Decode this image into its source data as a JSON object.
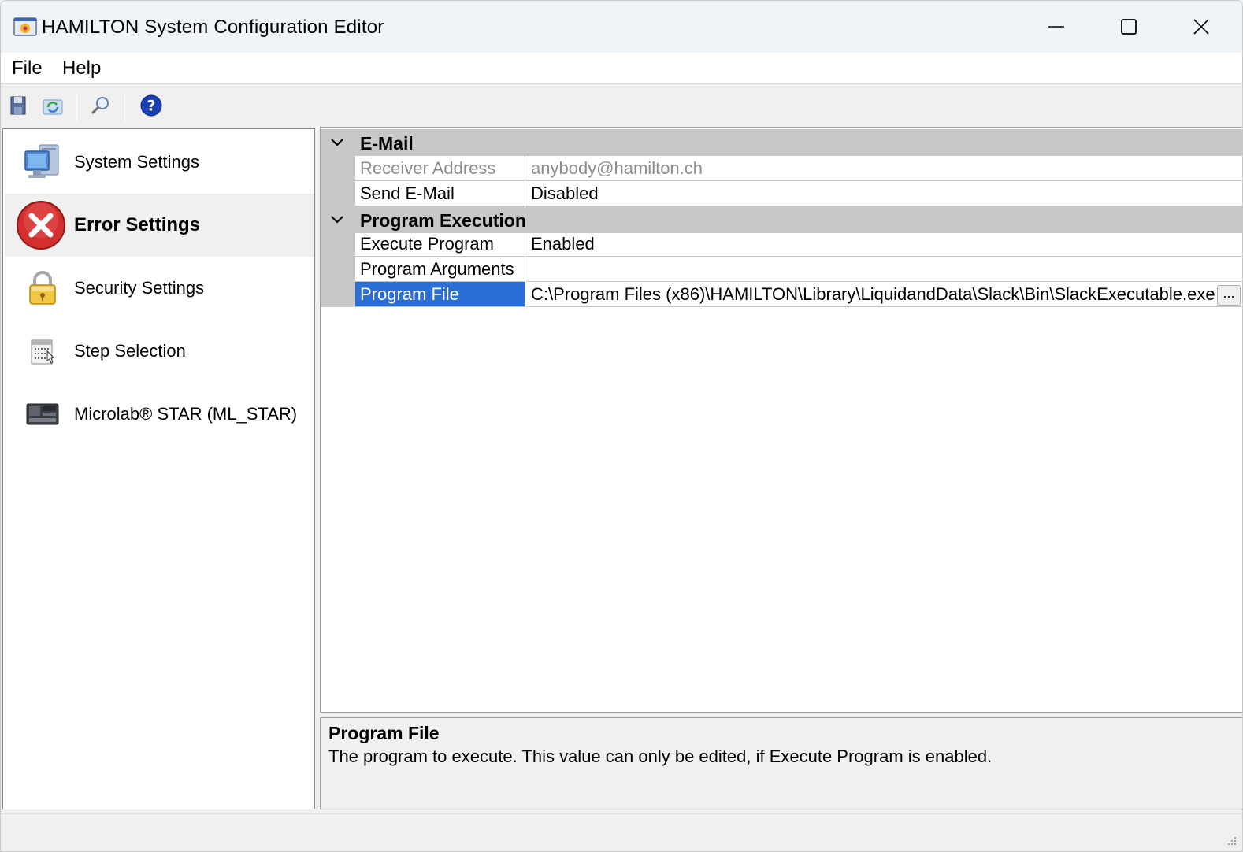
{
  "window": {
    "title": "HAMILTON System Configuration Editor",
    "app_icon": "hamilton-app-icon",
    "controls": [
      "minimize-icon",
      "maximize-icon",
      "close-icon"
    ]
  },
  "menu": {
    "items": [
      {
        "label": "File"
      },
      {
        "label": "Help"
      }
    ]
  },
  "toolbar": {
    "buttons": [
      {
        "icon": "save-icon"
      },
      {
        "icon": "refresh-icon"
      },
      {
        "icon": "search-icon"
      },
      {
        "icon": "help-icon",
        "glyph": "?"
      }
    ]
  },
  "nav": {
    "selected": "Error Settings",
    "items": [
      {
        "label": "System Settings",
        "icon": "computer-icon"
      },
      {
        "label": "Error Settings",
        "icon": "error-icon"
      },
      {
        "label": "Security Settings",
        "icon": "lock-icon"
      },
      {
        "label": "Step Selection",
        "icon": "step-selection-icon"
      },
      {
        "label": "Microlab® STAR (ML_STAR)",
        "icon": "instrument-icon"
      }
    ]
  },
  "property_grid": {
    "categories": [
      {
        "label": "E-Mail",
        "properties": [
          {
            "name": "Receiver Address",
            "value": "anybody@hamilton.ch",
            "readonly": true
          },
          {
            "name": "Send E-Mail",
            "value": "Disabled"
          }
        ]
      },
      {
        "label": "Program Execution",
        "properties": [
          {
            "name": "Execute Program",
            "value": "Enabled"
          },
          {
            "name": "Program Arguments",
            "value": ""
          },
          {
            "name": "Program File",
            "value": "C:\\Program Files (x86)\\HAMILTON\\Library\\LiquidandData\\Slack\\Bin\\SlackExecutable.exe",
            "selected": true,
            "button": "..."
          }
        ]
      }
    ]
  },
  "help_panel": {
    "title": "Program File",
    "description": "The program to execute. This value can only be edited, if Execute Program is enabled."
  },
  "colors": {
    "selection": "#2a6fd6",
    "category_bg": "#c8c8c8",
    "error_red": "#d32f2f",
    "help_blue": "#1a3fb0"
  }
}
